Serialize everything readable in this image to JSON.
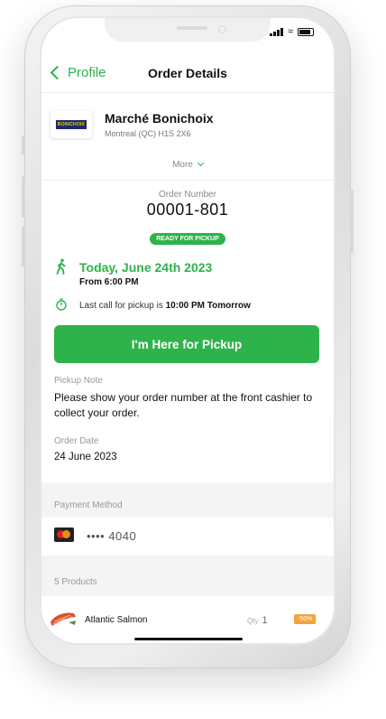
{
  "nav": {
    "back_label": "Profile",
    "title": "Order Details"
  },
  "store": {
    "logo_text": "BONICHOIX",
    "name": "Marché Bonichoix",
    "address": "Montreal (QC) H1S 2X6",
    "more_label": "More"
  },
  "order": {
    "number_label": "Order Number",
    "number": "00001-801",
    "status": "READY FOR PICKUP"
  },
  "pickup": {
    "date": "Today, June 24th 2023",
    "from": "From 6:00 PM",
    "last_call_prefix": "Last call for pickup is ",
    "last_call_time": "10:00 PM Tomorrow",
    "cta_label": "I'm Here for Pickup"
  },
  "note": {
    "label": "Pickup Note",
    "text": "Please show your order number at the front cashier to collect your order."
  },
  "order_date": {
    "label": "Order Date",
    "value": "24 June 2023"
  },
  "payment": {
    "label": "Payment Method",
    "card": "•••• 4040"
  },
  "products": {
    "label": "5 Products",
    "items": [
      {
        "name": "Atlantic Salmon",
        "qty_label": "Qty",
        "qty": "1",
        "discount": "-50%"
      }
    ]
  },
  "colors": {
    "accent": "#2db34a",
    "discount": "#f5a33a"
  }
}
